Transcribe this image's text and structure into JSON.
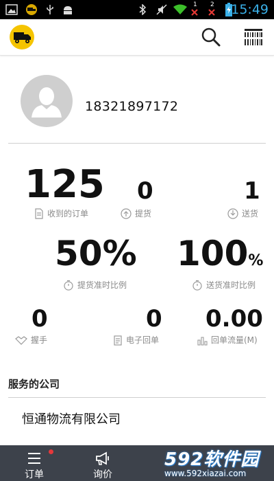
{
  "status_bar": {
    "time": "15:49",
    "icons": [
      "image-icon",
      "truck-notification-icon",
      "usb-icon",
      "android-icon",
      "bluetooth-icon",
      "mute-icon",
      "wifi-icon",
      "sim1-no-signal-icon",
      "sim2-no-signal-icon",
      "battery-charging-icon"
    ],
    "sim1_label": "1",
    "sim2_label": "2",
    "time_color": "#3ab0e8"
  },
  "app_bar": {
    "logo_icon": "truck-logo-icon",
    "logo_color": "#f5c400",
    "search_icon": "search-icon",
    "barcode_icon": "barcode-scan-icon"
  },
  "profile": {
    "avatar_icon": "user-avatar-icon",
    "phone": "18321897172"
  },
  "stats": {
    "received_orders": {
      "value": "125",
      "label": "收到的订单",
      "icon": "document-icon"
    },
    "pickup": {
      "value": "0",
      "label": "提货",
      "icon": "upload-circle-icon"
    },
    "delivery": {
      "value": "1",
      "label": "送货",
      "icon": "download-circle-icon"
    },
    "pickup_ontime": {
      "value": "50%",
      "label": "提货准时比例",
      "icon": "stopwatch-icon"
    },
    "delivery_ontime": {
      "value": "100",
      "unit": "%",
      "label": "送货准时比例",
      "icon": "stopwatch-icon"
    },
    "handshake": {
      "value": "0",
      "label": "握手",
      "icon": "handshake-icon"
    },
    "e_receipt": {
      "value": "0",
      "label": "电子回单",
      "icon": "receipt-icon"
    },
    "receipt_flow": {
      "value": "0.00",
      "label": "回单流量(M)",
      "icon": "bar-chart-icon"
    }
  },
  "companies": {
    "title": "服务的公司",
    "items": [
      "恒通物流有限公司"
    ]
  },
  "tab_bar": {
    "tabs": [
      {
        "label": "订单",
        "icon": "menu-list-icon",
        "badge": true
      },
      {
        "label": "询价",
        "icon": "megaphone-icon",
        "badge": false
      }
    ],
    "bg_color": "#3d424b"
  },
  "watermark": {
    "title": "592软件园",
    "url": "www.592xiazai.com"
  }
}
